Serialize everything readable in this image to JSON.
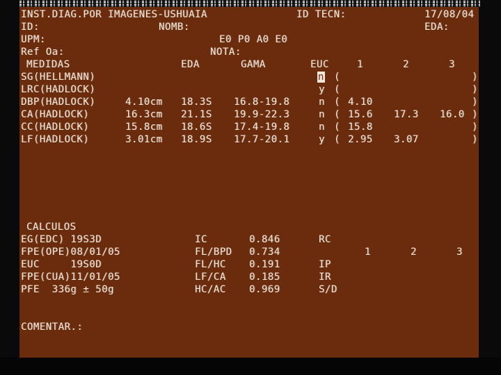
{
  "header": {
    "institution": "INST.DIAG.POR IMAGENES-USHUAIA",
    "id_tecn_label": "ID TECN:",
    "date": "17/08/04",
    "id_label": "ID:",
    "nomb_label": "NOMB:",
    "eda_label": "EDA:",
    "upm_label": "UPM:",
    "gpae": "E0 P0 A0 E0",
    "ref_label": "Ref Oa:",
    "nota_label": "NOTA:"
  },
  "measurements": {
    "headers": {
      "medidas": "MEDIDAS",
      "eda": "EDA",
      "gama": "GAMA",
      "euc": "EUC",
      "col1": "1",
      "col2": "2",
      "col3": "3"
    },
    "rows": [
      {
        "name": "SG(HELLMANN)",
        "value": "",
        "eda": "",
        "gama": "",
        "euc": "n",
        "m1": "",
        "m2": "",
        "m3": ""
      },
      {
        "name": "LRC(HADLOCK)",
        "value": "",
        "eda": "",
        "gama": "",
        "euc": "y",
        "m1": "",
        "m2": "",
        "m3": ""
      },
      {
        "name": "DBP(HADLOCK)",
        "value": "4.10cm",
        "eda": "18.3S",
        "gama": "16.8-19.8",
        "euc": "n",
        "m1": "4.10",
        "m2": "",
        "m3": ""
      },
      {
        "name": "CA(HADLOCK)",
        "value": "16.3cm",
        "eda": "21.1S",
        "gama": "19.9-22.3",
        "euc": "n",
        "m1": "15.6",
        "m2": "17.3",
        "m3": "16.0"
      },
      {
        "name": "CC(HADLOCK)",
        "value": "15.8cm",
        "eda": "18.6S",
        "gama": "17.4-19.8",
        "euc": "n",
        "m1": "15.8",
        "m2": "",
        "m3": ""
      },
      {
        "name": "LF(HADLOCK)",
        "value": "3.01cm",
        "eda": "18.9S",
        "gama": "17.7-20.1",
        "euc": "y",
        "m1": "2.95",
        "m2": "3.07",
        "m3": ""
      }
    ],
    "open_paren": "(",
    "close_paren": ")"
  },
  "calculos": {
    "title": "CALCULOS",
    "left": [
      "EG(EDC) 19S3D",
      "FPE(OPE)08/01/05",
      "EUC     19S0D",
      "FPE(CUA)11/01/05",
      "PFE  336g ± 50g"
    ],
    "ratios": [
      {
        "label": "IC",
        "value": "0.846"
      },
      {
        "label": "FL/BPD",
        "value": "0.734"
      },
      {
        "label": "FL/HC",
        "value": "0.191"
      },
      {
        "label": "LF/CA",
        "value": "0.185"
      },
      {
        "label": "HC/AC",
        "value": "0.969"
      }
    ],
    "indices": [
      "RC",
      "",
      "IP",
      "IR",
      "S/D"
    ],
    "index_cols": [
      "1",
      "2",
      "3"
    ]
  },
  "comment_label": "COMENTAR.:",
  "colors": {
    "panel": "#6a2c0c",
    "text": "#f2e6da"
  }
}
